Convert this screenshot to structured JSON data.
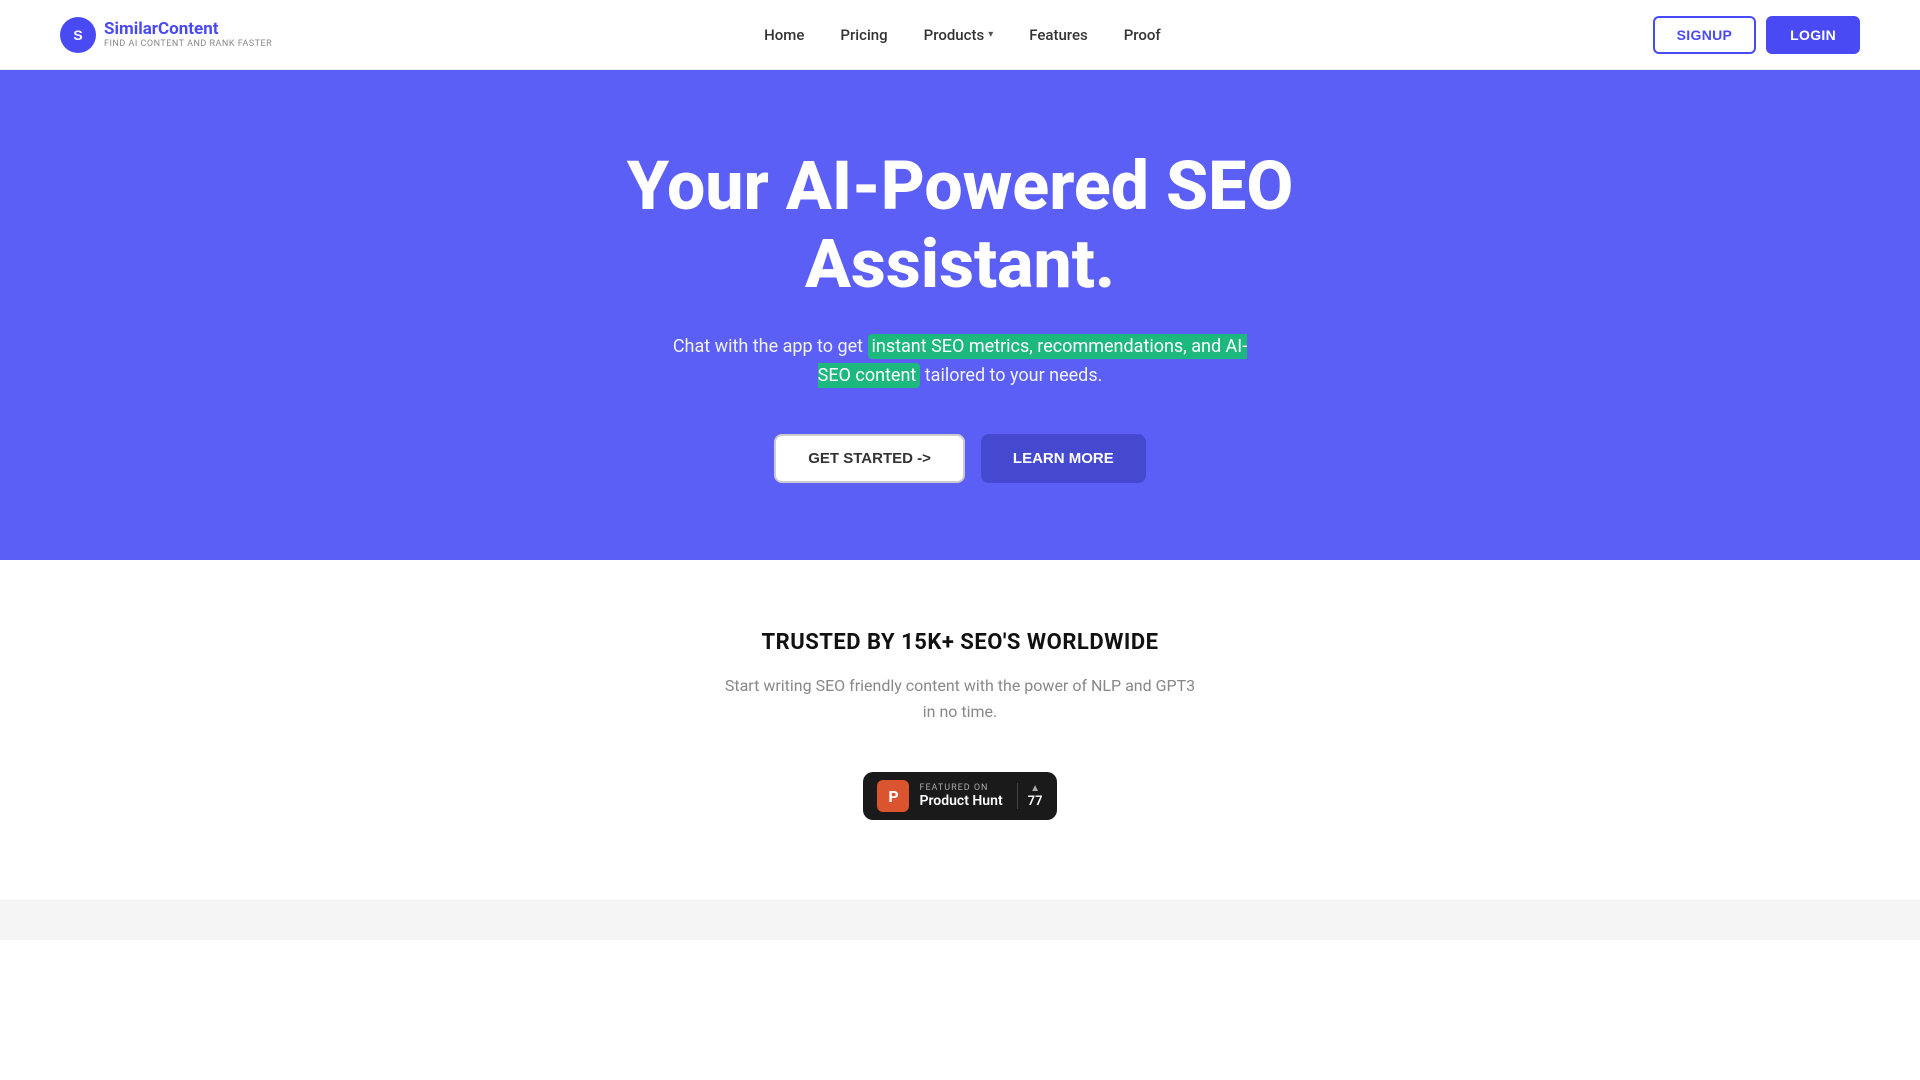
{
  "navbar": {
    "logo_brand": "SimilarContent",
    "logo_sub": "FIND AI CONTENT AND RANK FASTER",
    "links": [
      {
        "id": "home",
        "label": "Home"
      },
      {
        "id": "pricing",
        "label": "Pricing"
      },
      {
        "id": "products",
        "label": "Products"
      },
      {
        "id": "features",
        "label": "Features"
      },
      {
        "id": "proof",
        "label": "Proof"
      }
    ],
    "signup_label": "SIGNUP",
    "login_label": "LOGIN"
  },
  "hero": {
    "title": "Your AI-Powered SEO Assistant.",
    "subtitle_before": "Chat with the app to get ",
    "subtitle_highlight": "instant SEO metrics, recommendations, and AI-SEO content",
    "subtitle_after": " tailored to your needs.",
    "get_started_label": "GET STARTED ->",
    "learn_more_label": "LEARN MORE"
  },
  "trusted": {
    "title": "TRUSTED BY 15K+ SEO'S WORLDWIDE",
    "description": "Start writing SEO friendly content with the power of NLP and GPT3\nin no time.",
    "product_hunt": {
      "featured_on": "FEATURED ON",
      "name": "Product Hunt",
      "votes": "77"
    }
  }
}
